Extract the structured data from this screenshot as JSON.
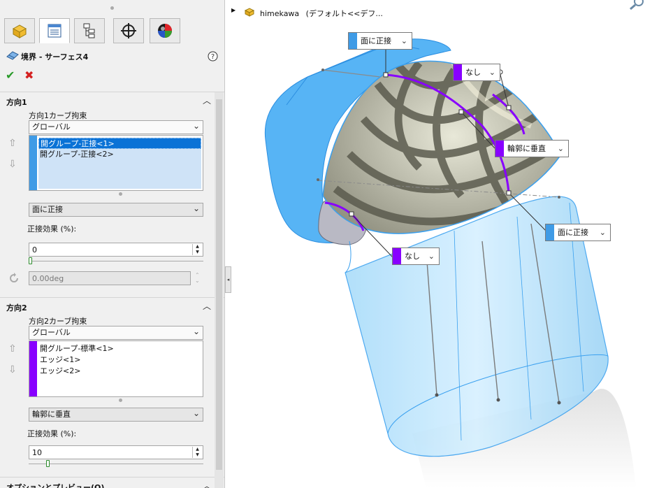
{
  "colors": {
    "blue_accent": "#3f9be6",
    "purple_accent": "#8800ff",
    "selection": "#0a72d6",
    "ok_green": "#2a9b2a",
    "cancel_red": "#d42020"
  },
  "tabs": [
    {
      "name": "feature-manager-icon"
    },
    {
      "name": "property-manager-icon"
    },
    {
      "name": "configuration-manager-icon"
    },
    {
      "name": "dimxpert-icon"
    },
    {
      "name": "display-manager-icon"
    }
  ],
  "feature": {
    "title": "境界 - サーフェス4",
    "help_icon": "help-icon",
    "ok_icon": "ok-check-icon",
    "cancel_icon": "cancel-x-icon"
  },
  "dir1": {
    "header": "方向1",
    "curve_label": "方向1カーブ拘束",
    "scope": "グローバル",
    "items": [
      "開グループ-正接<1>",
      "開グループ-正接<2>"
    ],
    "constraint": "面に正接",
    "tangent_label": "正接効果 (%):",
    "tangent_value": "0",
    "tangent_fraction": 0.0,
    "angle_value": "0.00deg"
  },
  "dir2": {
    "header": "方向2",
    "curve_label": "方向2カーブ拘束",
    "scope": "グローバル",
    "items": [
      "開グループ-標準<1>",
      "エッジ<1>",
      "エッジ<2>"
    ],
    "constraint": "輪郭に垂直",
    "tangent_label": "正接効果 (%):",
    "tangent_value": "10",
    "tangent_fraction": 0.1
  },
  "options": {
    "header": "オプションとプレビュー(O)"
  },
  "tree": {
    "part_name": "himekawa",
    "config": "(デフォルト<<デフ..."
  },
  "callouts": {
    "top_tangent": "面に正接",
    "none_top": "なし",
    "normal_profile": "輪郭に垂直",
    "right_tangent": "面に正接",
    "none_bottom": "なし"
  }
}
